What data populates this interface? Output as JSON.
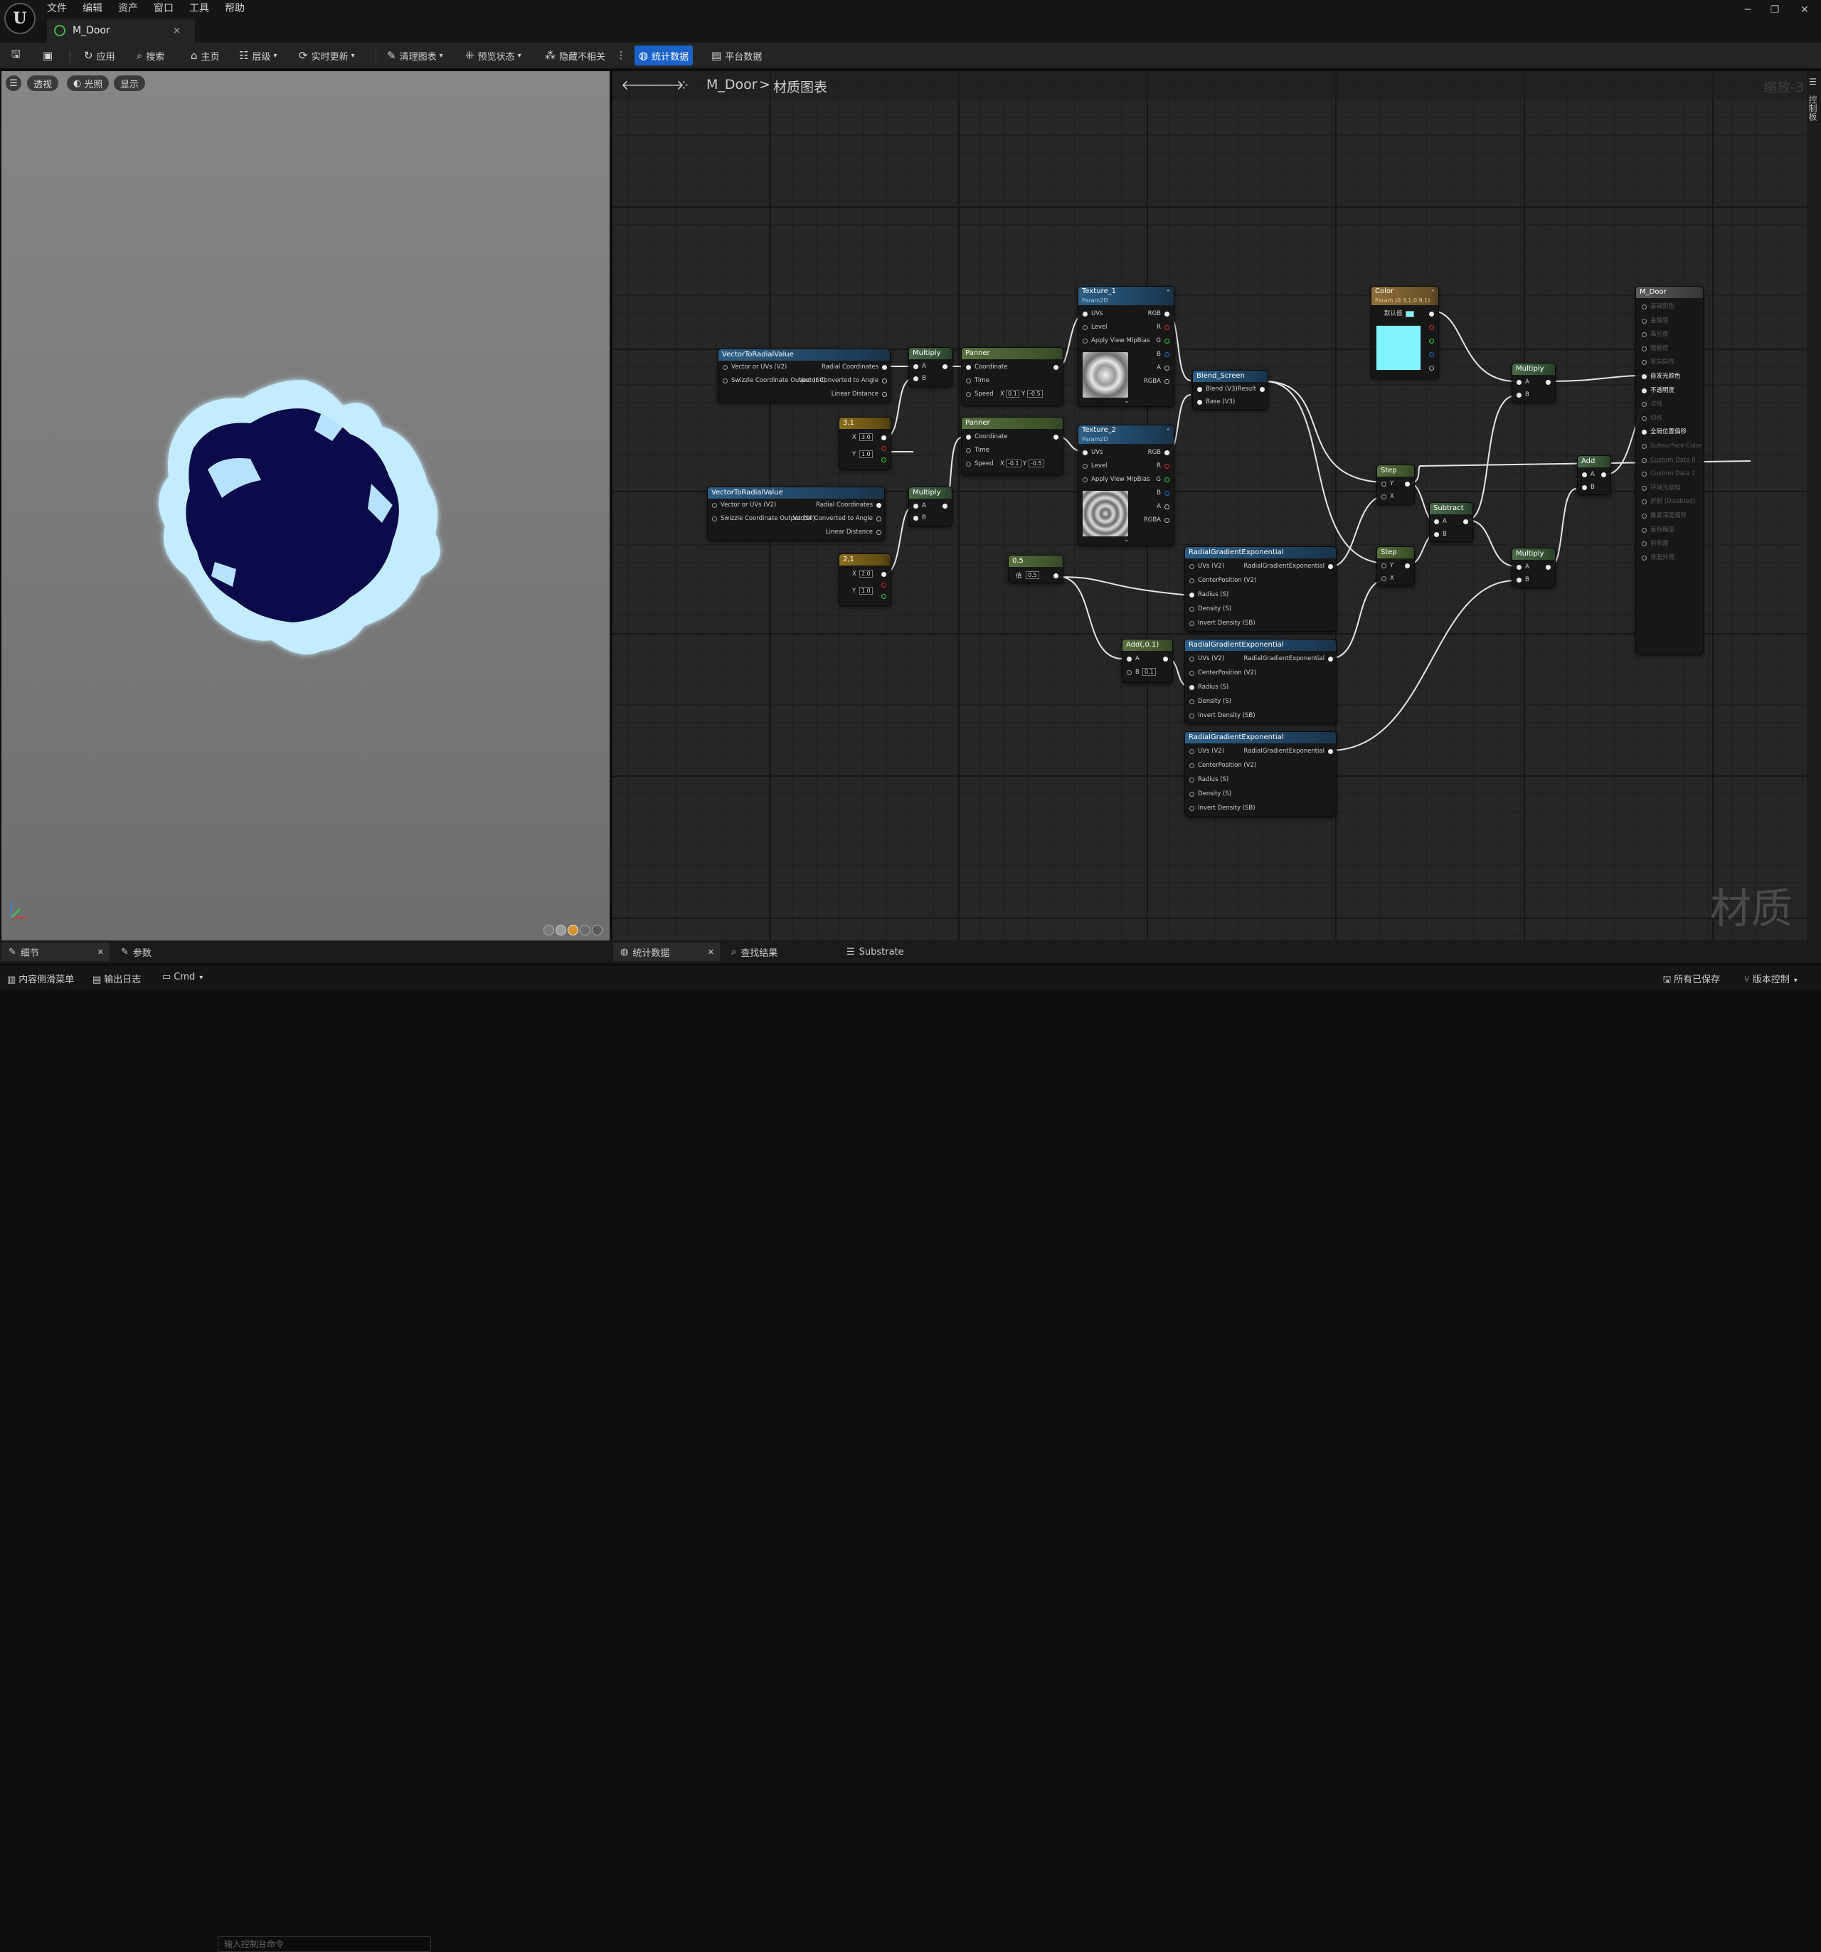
{
  "menu": [
    "文件",
    "编辑",
    "资产",
    "窗口",
    "工具",
    "帮助"
  ],
  "logo": "U",
  "tab": {
    "title": "M_Door",
    "close": "×"
  },
  "window_controls": {
    "minimize": "─",
    "restore": "❐",
    "close": "✕"
  },
  "toolbar": {
    "apply": "应用",
    "search": "搜索",
    "home": "主页",
    "hierarchy": "层级",
    "live_update": "实时更新",
    "clean_graph": "清理图表",
    "preview_state": "预览状态",
    "hide_unrelated": "隐藏不相关",
    "stats": "统计数据",
    "platform_stats": "平台数据"
  },
  "viewport": {
    "perspective": "透视",
    "lit": "光照",
    "show": "显示"
  },
  "graph": {
    "breadcrumb_asset": "M_Door",
    "breadcrumb_sep": ">",
    "breadcrumb_graph": "材质图表",
    "zoom": "缩放-3",
    "watermark": "材质",
    "right_rail": "控制板"
  },
  "nodes": {
    "vtr1": {
      "title": "VectorToRadialValue",
      "in1": "Vector or UVs (V2)",
      "out1": "Radial Coordinates",
      "in2": "Swizzle Coordinate Output (S0)",
      "out2": "Vector Converted to Angle",
      "out3": "Linear Distance"
    },
    "vtr2": {
      "title": "VectorToRadialValue",
      "in1": "Vector or UVs (V2)",
      "out1": "Radial Coordinates",
      "in2": "Swizzle Coordinate Output (S0)",
      "out2": "Vector Converted to Angle",
      "out3": "Linear Distance"
    },
    "mul1": {
      "title": "Multiply",
      "a": "A",
      "b": "B"
    },
    "mul2": {
      "title": "Multiply",
      "a": "A",
      "b": "B"
    },
    "c31": {
      "title": "3,1",
      "x": "X",
      "xv": "3.0",
      "y": "Y",
      "yv": "1.0"
    },
    "c21": {
      "title": "2,1",
      "x": "X",
      "xv": "2.0",
      "y": "Y",
      "yv": "1.0"
    },
    "pan1": {
      "title": "Panner",
      "coord": "Coordinate",
      "time": "Time",
      "speed": "Speed",
      "sx": "X",
      "sxv": "0.1",
      "sy": "Y",
      "syv": "-0.5"
    },
    "pan2": {
      "title": "Panner",
      "coord": "Coordinate",
      "time": "Time",
      "speed": "Speed",
      "sx": "X",
      "sxv": "-0.1",
      "sy": "Y",
      "syv": "-0.5"
    },
    "tex1": {
      "title": "Texture_1",
      "sub": "Param2D",
      "uvs": "UVs",
      "rgb": "RGB",
      "level": "Level",
      "r": "R",
      "mip": "Apply View MipBias",
      "g": "G",
      "b": "B",
      "a": "A",
      "rgba": "RGBA"
    },
    "tex2": {
      "title": "Texture_2",
      "sub": "Param2D",
      "uvs": "UVs",
      "rgb": "RGB",
      "level": "Level",
      "r": "R",
      "mip": "Apply View MipBias",
      "g": "G",
      "b": "B",
      "a": "A",
      "rgba": "RGBA"
    },
    "blend": {
      "title": "Blend_Screen",
      "in1": "Blend (V3)",
      "out": "Result",
      "in2": "Base (V3)"
    },
    "const05": {
      "title": "0.5",
      "label": "值",
      "value": "0.5"
    },
    "add01": {
      "title": "Add(,0.1)",
      "a": "A",
      "b": "B",
      "bv": "0.1"
    },
    "rg1": {
      "title": "RadialGradientExponential",
      "in1": "UVs (V2)",
      "out": "RadialGradientExponential",
      "in2": "CenterPosition (V2)",
      "in3": "Radius (S)",
      "in4": "Density (S)",
      "in5": "Invert Density (SB)"
    },
    "rg2": {
      "title": "RadialGradientExponential",
      "in1": "UVs (V2)",
      "out": "RadialGradientExponential",
      "in2": "CenterPosition (V2)",
      "in3": "Radius (S)",
      "in4": "Density (S)",
      "in5": "Invert Density (SB)"
    },
    "rg3": {
      "title": "RadialGradientExponential",
      "in1": "UVs (V2)",
      "out": "RadialGradientExponential",
      "in2": "CenterPosition (V2)",
      "in3": "Radius (S)",
      "in4": "Density (S)",
      "in5": "Invert Density (SB)"
    },
    "color": {
      "title": "Color",
      "sub": "Param (0.3,1,0.9,1)",
      "default": "默认值",
      "swatch": "#7ff5ff"
    },
    "step1": {
      "title": "Step",
      "y": "Y",
      "x": "X"
    },
    "step2": {
      "title": "Step",
      "y": "Y",
      "x": "X"
    },
    "subtract": {
      "title": "Subtract",
      "a": "A",
      "b": "B"
    },
    "mul3": {
      "title": "Multiply",
      "a": "A",
      "b": "B"
    },
    "mul4": {
      "title": "Multiply",
      "a": "A",
      "b": "B"
    },
    "add": {
      "title": "Add",
      "a": "A",
      "b": "B"
    },
    "result": {
      "title": "M_Door",
      "pins": [
        "基础颜色",
        "金属感",
        "高光度",
        "粗糙度",
        "各向异性",
        "自发光颜色",
        "不透明度",
        "法线",
        "切线",
        "全局位置偏移",
        "Subsurface Color",
        "Custom Data 0",
        "Custom Data 1",
        "环境光遮挡",
        "折射 (Disabled)",
        "像素深度偏移",
        "着色模型",
        "前表面",
        "背面外观"
      ]
    }
  },
  "bottom_tabs": {
    "details": "细节",
    "params": "参数",
    "stats": "统计数据",
    "find": "查找结果",
    "substrate": "Substrate"
  },
  "status": {
    "content_drawer": "内容侧滑菜单",
    "output_log": "输出日志",
    "cmd": "Cmd",
    "console_placeholder": "输入控制台命令",
    "all_saved": "所有已保存",
    "version_control": "版本控制"
  }
}
